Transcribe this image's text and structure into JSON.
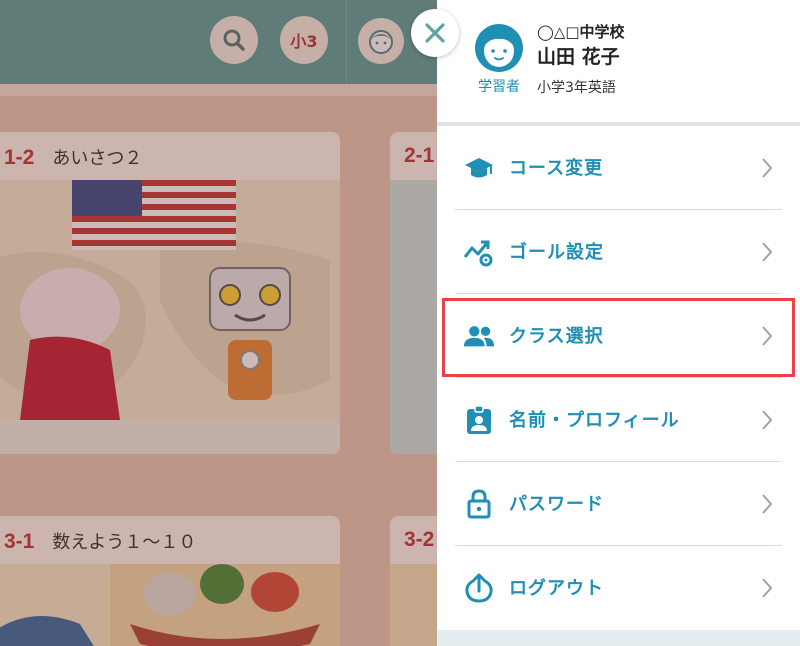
{
  "header": {
    "grade_label": "小3"
  },
  "cards": [
    {
      "number": "1-2",
      "title": "あいさつ２"
    },
    {
      "number": "2-1",
      "title": ""
    },
    {
      "number": "3-1",
      "title": "数えよう１〜１０"
    },
    {
      "number": "3-2",
      "title": ""
    }
  ],
  "drawer": {
    "close_icon": "close-icon",
    "profile": {
      "role": "学習者",
      "school": "◯△□中学校",
      "name": "山田 花子",
      "course": "小学3年英語"
    },
    "menu": [
      {
        "label": "コース変更",
        "icon": "graduation-cap-icon"
      },
      {
        "label": "ゴール設定",
        "icon": "goal-settings-icon"
      },
      {
        "label": "クラス選択",
        "icon": "people-icon",
        "highlighted": true
      },
      {
        "label": "名前・プロフィール",
        "icon": "id-badge-icon"
      },
      {
        "label": "パスワード",
        "icon": "lock-icon"
      },
      {
        "label": "ログアウト",
        "icon": "logout-icon"
      }
    ]
  },
  "colors": {
    "accent": "#1f8fb4",
    "header_bg": "#5fa3a0",
    "highlight_border": "#e8414a",
    "card_number": "#c2383a"
  }
}
